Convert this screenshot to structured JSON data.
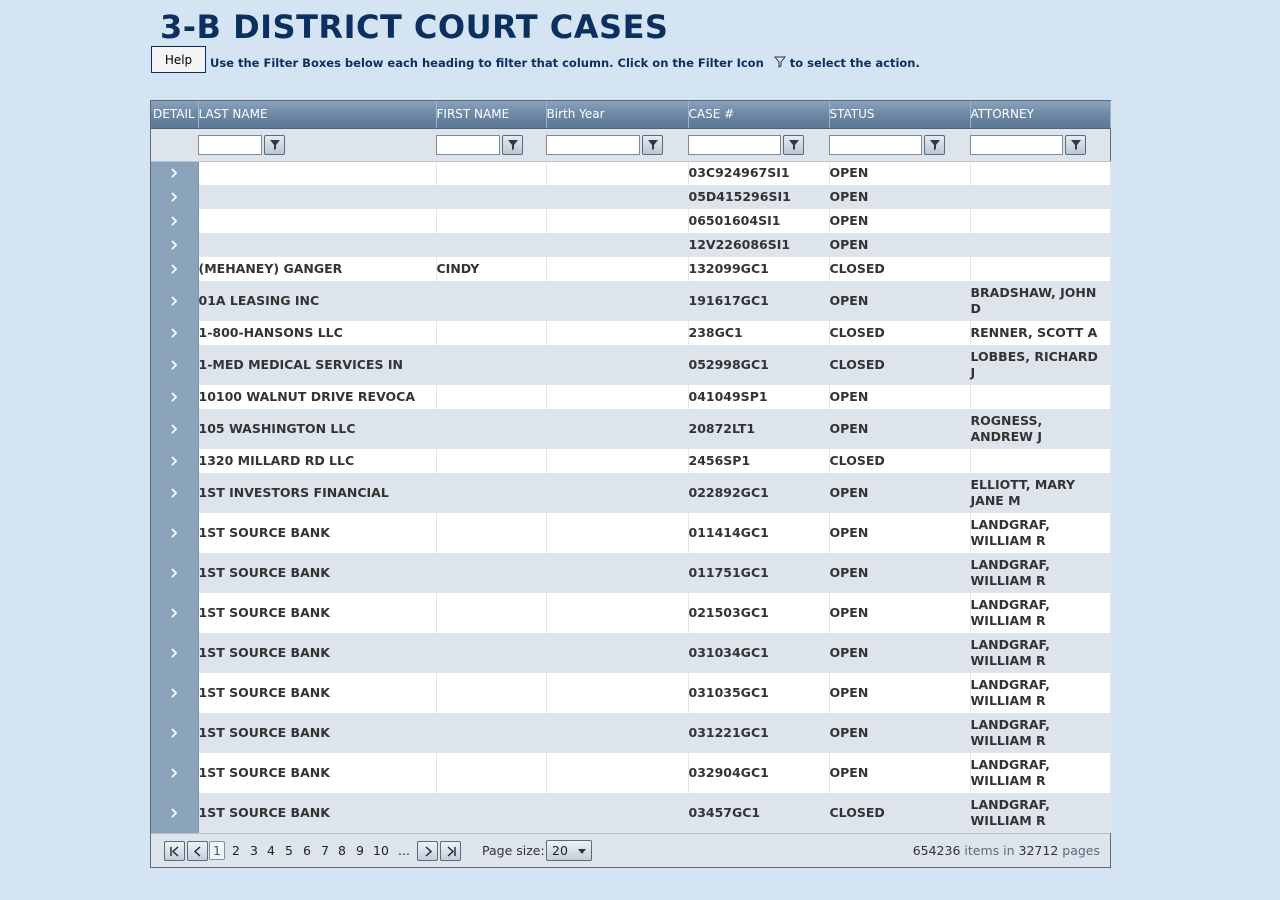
{
  "page": {
    "title": "3-B DISTRICT COURT CASES",
    "help_label": "Help",
    "instructions_part1": "Use the Filter Boxes below each heading to filter that column.  Click on the Filter Icon",
    "instructions_part2": "to select the action."
  },
  "columns": {
    "detail": "DETAIL",
    "last_name": "LAST NAME",
    "first_name": "FIRST NAME",
    "birth_year": "Birth Year",
    "case_no": "CASE #",
    "status": "STATUS",
    "attorney": "ATTORNEY"
  },
  "rows": [
    {
      "last": "",
      "first": "",
      "birth": "",
      "case": "03C924967SI1",
      "status": "OPEN",
      "attorney": ""
    },
    {
      "last": "",
      "first": "",
      "birth": "",
      "case": "05D415296SI1",
      "status": "OPEN",
      "attorney": ""
    },
    {
      "last": "",
      "first": "",
      "birth": "",
      "case": "06501604SI1",
      "status": "OPEN",
      "attorney": ""
    },
    {
      "last": "",
      "first": "",
      "birth": "",
      "case": "12V226086SI1",
      "status": "OPEN",
      "attorney": ""
    },
    {
      "last": "(MEHANEY) GANGER",
      "first": "CINDY",
      "birth": "",
      "case": "132099GC1",
      "status": "CLOSED",
      "attorney": ""
    },
    {
      "last": "01A LEASING INC",
      "first": "",
      "birth": "",
      "case": "191617GC1",
      "status": "OPEN",
      "attorney": "BRADSHAW, JOHN D"
    },
    {
      "last": "1-800-HANSONS LLC",
      "first": "",
      "birth": "",
      "case": "238GC1",
      "status": "CLOSED",
      "attorney": "RENNER, SCOTT A"
    },
    {
      "last": "1-MED MEDICAL SERVICES IN",
      "first": "",
      "birth": "",
      "case": "052998GC1",
      "status": "CLOSED",
      "attorney": "LOBBES, RICHARD J"
    },
    {
      "last": "10100 WALNUT DRIVE REVOCA",
      "first": "",
      "birth": "",
      "case": "041049SP1",
      "status": "OPEN",
      "attorney": ""
    },
    {
      "last": "105 WASHINGTON LLC",
      "first": "",
      "birth": "",
      "case": "20872LT1",
      "status": "OPEN",
      "attorney": "ROGNESS, ANDREW J"
    },
    {
      "last": "1320 MILLARD RD LLC",
      "first": "",
      "birth": "",
      "case": "2456SP1",
      "status": "CLOSED",
      "attorney": ""
    },
    {
      "last": "1ST INVESTORS FINANCIAL",
      "first": "",
      "birth": "",
      "case": "022892GC1",
      "status": "OPEN",
      "attorney": "ELLIOTT, MARY JANE M"
    },
    {
      "last": "1ST SOURCE BANK",
      "first": "",
      "birth": "",
      "case": "011414GC1",
      "status": "OPEN",
      "attorney": "LANDGRAF, WILLIAM R"
    },
    {
      "last": "1ST SOURCE BANK",
      "first": "",
      "birth": "",
      "case": "011751GC1",
      "status": "OPEN",
      "attorney": "LANDGRAF, WILLIAM R"
    },
    {
      "last": "1ST SOURCE BANK",
      "first": "",
      "birth": "",
      "case": "021503GC1",
      "status": "OPEN",
      "attorney": "LANDGRAF, WILLIAM R"
    },
    {
      "last": "1ST SOURCE BANK",
      "first": "",
      "birth": "",
      "case": "031034GC1",
      "status": "OPEN",
      "attorney": "LANDGRAF, WILLIAM R"
    },
    {
      "last": "1ST SOURCE BANK",
      "first": "",
      "birth": "",
      "case": "031035GC1",
      "status": "OPEN",
      "attorney": "LANDGRAF, WILLIAM R"
    },
    {
      "last": "1ST SOURCE BANK",
      "first": "",
      "birth": "",
      "case": "031221GC1",
      "status": "OPEN",
      "attorney": "LANDGRAF, WILLIAM R"
    },
    {
      "last": "1ST SOURCE BANK",
      "first": "",
      "birth": "",
      "case": "032904GC1",
      "status": "OPEN",
      "attorney": "LANDGRAF, WILLIAM R"
    },
    {
      "last": "1ST SOURCE BANK",
      "first": "",
      "birth": "",
      "case": "03457GC1",
      "status": "CLOSED",
      "attorney": "LANDGRAF, WILLIAM R"
    }
  ],
  "pager": {
    "current_page": "1",
    "pages": [
      "2",
      "3",
      "4",
      "5",
      "6",
      "7",
      "8",
      "9",
      "10",
      "..."
    ],
    "page_size_label": "Page size:",
    "page_size": "20",
    "total_items": "654236",
    "items_in_text": "items in",
    "total_pages": "32712",
    "pages_text": "pages"
  },
  "icons": {
    "filter": "filter-icon",
    "detail": "chevron-right-icon",
    "first": "first-page-icon",
    "prev": "prev-page-icon",
    "next": "next-page-icon",
    "last": "last-page-icon"
  },
  "colors": {
    "title": "#0b2f5e",
    "background": "#d5e4f3",
    "header": "#6a86a3",
    "detail_column": "#8ba3bb",
    "alt_row": "#dde4eb"
  }
}
